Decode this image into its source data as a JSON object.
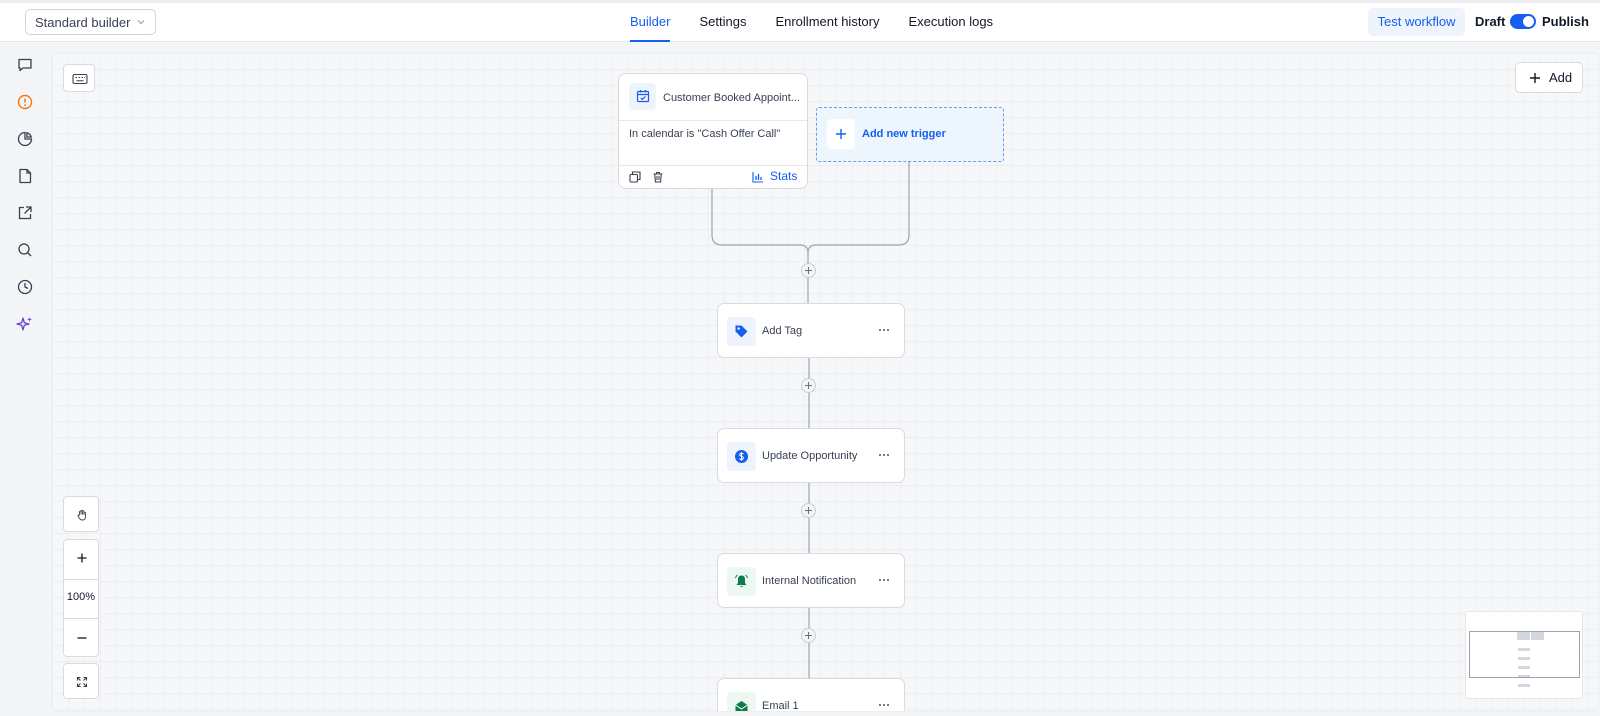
{
  "header": {
    "builder_select": "Standard builder",
    "tabs": [
      {
        "label": "Builder",
        "active": true
      },
      {
        "label": "Settings",
        "active": false
      },
      {
        "label": "Enrollment history",
        "active": false
      },
      {
        "label": "Execution logs",
        "active": false
      }
    ],
    "test_workflow": "Test workflow",
    "draft_label": "Draft",
    "publish_label": "Publish",
    "published": true
  },
  "sidebar": {
    "icons": [
      "chat-icon",
      "alert-icon",
      "pie-chart-icon",
      "document-icon",
      "external-link-icon",
      "search-icon",
      "history-icon",
      "sparkles-icon"
    ]
  },
  "canvas": {
    "add_label": "Add",
    "zoom": "100%",
    "trigger": {
      "title": "Customer Booked Appoint...",
      "condition": "In calendar is \"Cash Offer Call\"",
      "stats_label": "Stats"
    },
    "add_trigger_label": "Add new trigger",
    "actions": [
      {
        "label": "Add Tag",
        "icon": "tag-icon"
      },
      {
        "label": "Update Opportunity",
        "icon": "dollar-icon"
      },
      {
        "label": "Internal Notification",
        "icon": "bell-icon"
      },
      {
        "label": "Email 1",
        "icon": "email-icon"
      }
    ]
  },
  "colors": {
    "accent": "#155eef",
    "tag_icon": "#155eef",
    "notification_icon": "#0e7c4a",
    "alert_icon": "#f97316",
    "sparkles_icon": "#6d3fd8"
  }
}
